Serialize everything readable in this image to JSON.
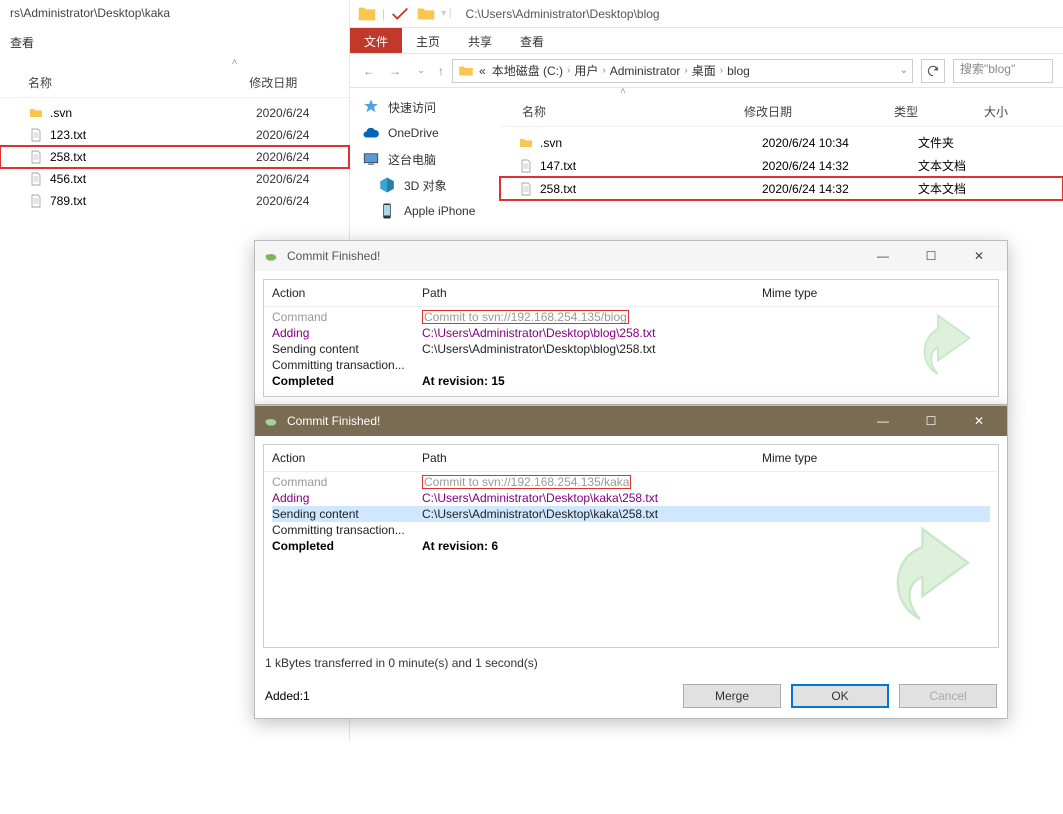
{
  "left": {
    "title_path": "rs\\Administrator\\Desktop\\kaka",
    "menu_view": "查看",
    "col_name": "名称",
    "col_date": "修改日期",
    "files": [
      {
        "name": ".svn",
        "date": "2020/6/24",
        "icon": "folder",
        "highlight": false
      },
      {
        "name": "123.txt",
        "date": "2020/6/24",
        "icon": "file",
        "highlight": false
      },
      {
        "name": "258.txt",
        "date": "2020/6/24",
        "icon": "file",
        "highlight": true
      },
      {
        "name": "456.txt",
        "date": "2020/6/24",
        "icon": "file",
        "highlight": false
      },
      {
        "name": "789.txt",
        "date": "2020/6/24",
        "icon": "file",
        "highlight": false
      }
    ]
  },
  "right": {
    "top_path": "C:\\Users\\Administrator\\Desktop\\blog",
    "ribbon": {
      "file": "文件",
      "home": "主页",
      "share": "共享",
      "view": "查看"
    },
    "breadcrumb": {
      "prefix": "«",
      "disk": "本地磁盘 (C:)",
      "users": "用户",
      "admin": "Administrator",
      "desktop": "桌面",
      "folder": "blog"
    },
    "search_placeholder": "搜索\"blog\"",
    "cols": {
      "name": "名称",
      "date": "修改日期",
      "type": "类型",
      "size": "大小"
    },
    "sidebar": {
      "quick": "快速访问",
      "onedrive": "OneDrive",
      "thispc": "这台电脑",
      "obj3d": "3D 对象",
      "iphone": "Apple iPhone"
    },
    "files": [
      {
        "name": ".svn",
        "date": "2020/6/24 10:34",
        "type": "文件夹",
        "icon": "folder",
        "highlight": false
      },
      {
        "name": "147.txt",
        "date": "2020/6/24 14:32",
        "type": "文本文档",
        "icon": "file",
        "highlight": false
      },
      {
        "name": "258.txt",
        "date": "2020/6/24 14:32",
        "type": "文本文档",
        "icon": "file",
        "highlight": true
      }
    ]
  },
  "dlg1": {
    "title": "Commit Finished!",
    "cols": {
      "action": "Action",
      "path": "Path",
      "mime": "Mime type"
    },
    "rows": {
      "command_a": "Command",
      "command_p": "Commit to svn://192.168.254.135/blog",
      "adding_a": "Adding",
      "adding_p": "C:\\Users\\Administrator\\Desktop\\blog\\258.txt",
      "sending_a": "Sending content",
      "sending_p": "C:\\Users\\Administrator\\Desktop\\blog\\258.txt",
      "committing_a": "Committing transaction...",
      "completed_a": "Completed",
      "completed_p": "At revision: 15"
    }
  },
  "dlg2": {
    "title": "Commit Finished!",
    "cols": {
      "action": "Action",
      "path": "Path",
      "mime": "Mime type"
    },
    "rows": {
      "command_a": "Command",
      "command_p": "Commit to svn://192.168.254.135/kaka",
      "adding_a": "Adding",
      "adding_p": "C:\\Users\\Administrator\\Desktop\\kaka\\258.txt",
      "sending_a": "Sending content",
      "sending_p": "C:\\Users\\Administrator\\Desktop\\kaka\\258.txt",
      "committing_a": "Committing transaction...",
      "completed_a": "Completed",
      "completed_p": "At revision: 6"
    },
    "status": "1 kBytes transferred in 0 minute(s) and 1 second(s)",
    "added": "Added:1",
    "buttons": {
      "merge": "Merge",
      "ok": "OK",
      "cancel": "Cancel"
    }
  }
}
